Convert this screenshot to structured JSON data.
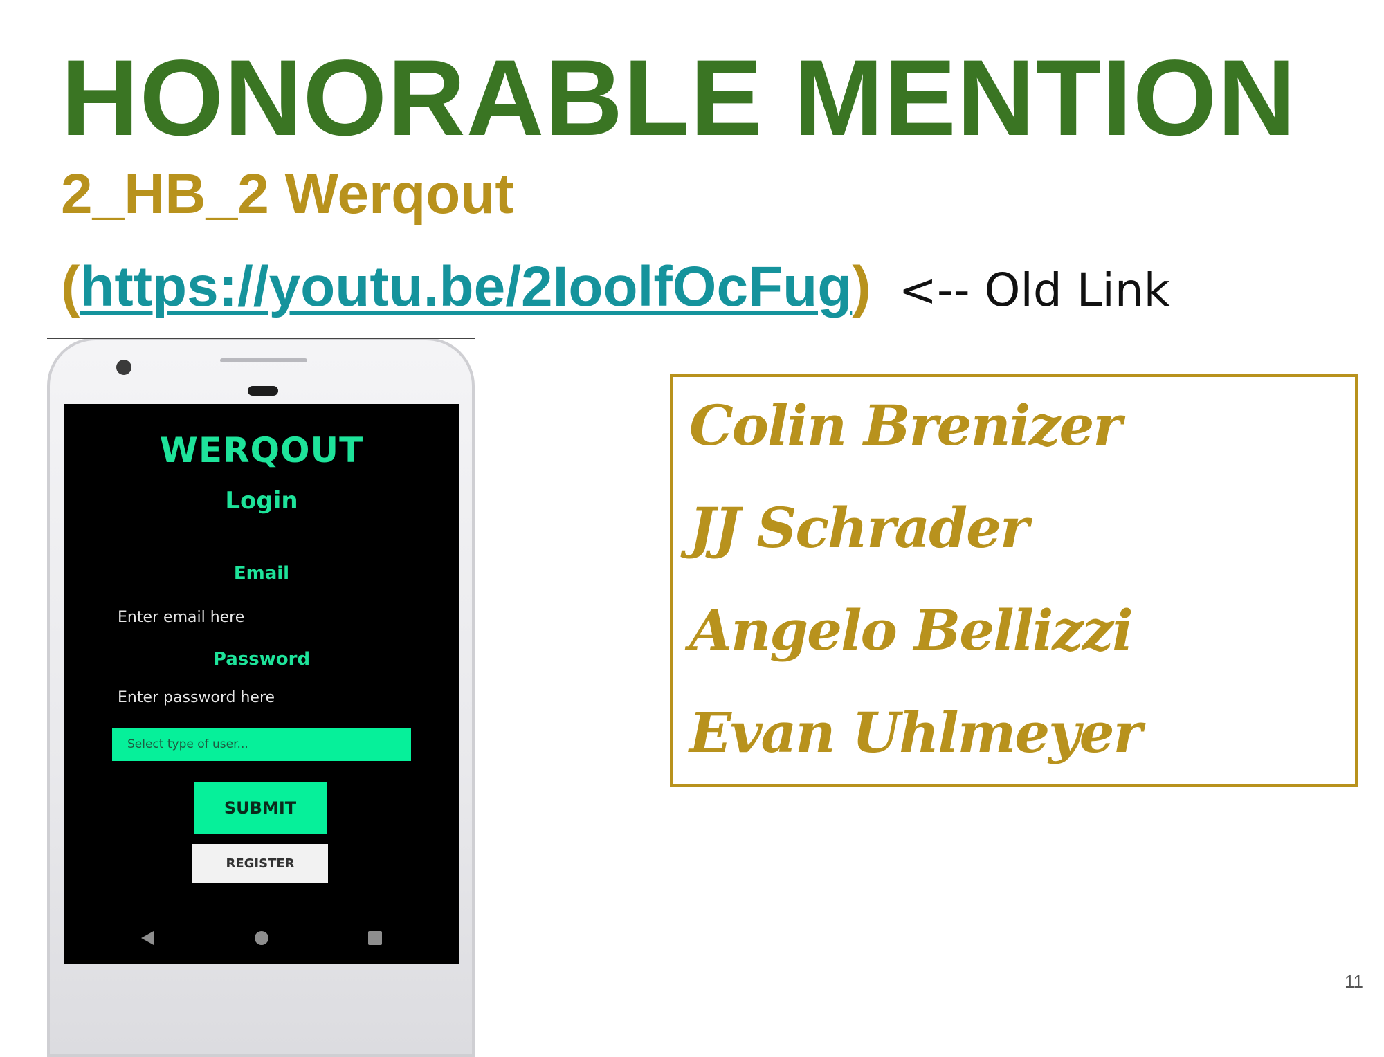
{
  "slide": {
    "title": "HONORABLE MENTION",
    "subtitle": "2_HB_2 Werqout",
    "link_open_paren": "(",
    "link_url": "https://youtu.be/2IoolfOcFug",
    "link_close_paren": ")",
    "link_note": "<-- Old Link",
    "page_number": "11"
  },
  "phone_app": {
    "app_name": "WERQOUT",
    "screen_title": "Login",
    "email_label": "Email",
    "email_placeholder": "Enter email here",
    "password_label": "Password",
    "password_placeholder": "Enter password here",
    "user_type_placeholder": "Select type of user...",
    "submit_label": "SUBMIT",
    "register_label": "REGISTER",
    "nav": {
      "back_icon": "back-triangle-icon",
      "home_icon": "home-circle-icon",
      "recents_icon": "recents-square-icon"
    }
  },
  "team_members": [
    "Colin Brenizer",
    "JJ Schrader",
    "Angelo Bellizzi",
    "Evan Uhlmeyer"
  ],
  "colors": {
    "title_green": "#3a7523",
    "gold": "#b8921d",
    "link_teal": "#15939c",
    "app_accent": "#06f09a",
    "app_text_green": "#1ee39a"
  }
}
